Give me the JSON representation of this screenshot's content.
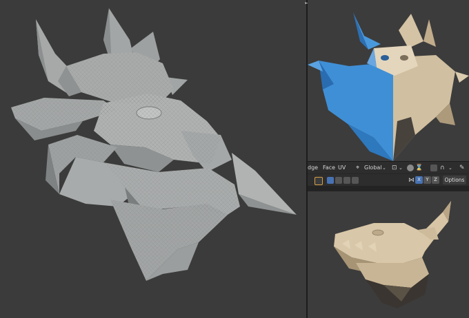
{
  "editor": {
    "split_icon": "split-arrows-icon",
    "header": {
      "menu_edge": "dge",
      "menu_face": "Face",
      "menu_uv": "UV",
      "transform_orientation": "Global",
      "options_label": "Options",
      "axis_x": "X",
      "axis_y": "Y",
      "axis_z": "Z"
    }
  },
  "colors": {
    "viewport_bg": "#3b3b3b",
    "clay_gray": "#9a9c9c",
    "beige": "#cbb89a",
    "blue_normal": "#3f8fd6",
    "accent": "#4772b3"
  }
}
